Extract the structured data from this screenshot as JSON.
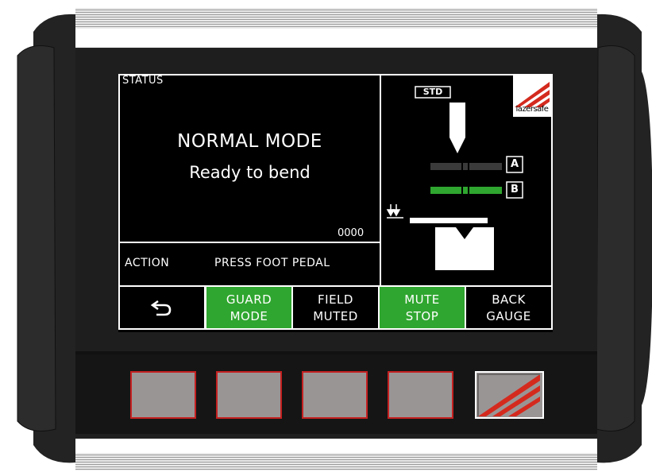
{
  "status": {
    "label": "STATUS",
    "mode": "NORMAL MODE",
    "message": "Ready to bend",
    "counter": "0000"
  },
  "action": {
    "label": "ACTION",
    "text": "PRESS FOOT PEDAL"
  },
  "diagram": {
    "std_label": "STD",
    "brand": "lazersafe",
    "beam_a_label": "A",
    "beam_b_label": "B",
    "beam_a_state": "blocked",
    "beam_b_state": "clear"
  },
  "softkeys": [
    {
      "label_1": "GUARD",
      "label_2": "MODE",
      "state": "active"
    },
    {
      "label_1": "FIELD",
      "label_2": "MUTED",
      "state": "inactive"
    },
    {
      "label_1": "MUTE",
      "label_2": "STOP",
      "state": "active"
    },
    {
      "label_1": "BACK",
      "label_2": "GAUGE",
      "state": "inactive"
    }
  ],
  "colors": {
    "active_green": "#2fa62f",
    "brand_red": "#d42a1e",
    "button_border": "#c52020",
    "button_face": "#9a9595"
  }
}
